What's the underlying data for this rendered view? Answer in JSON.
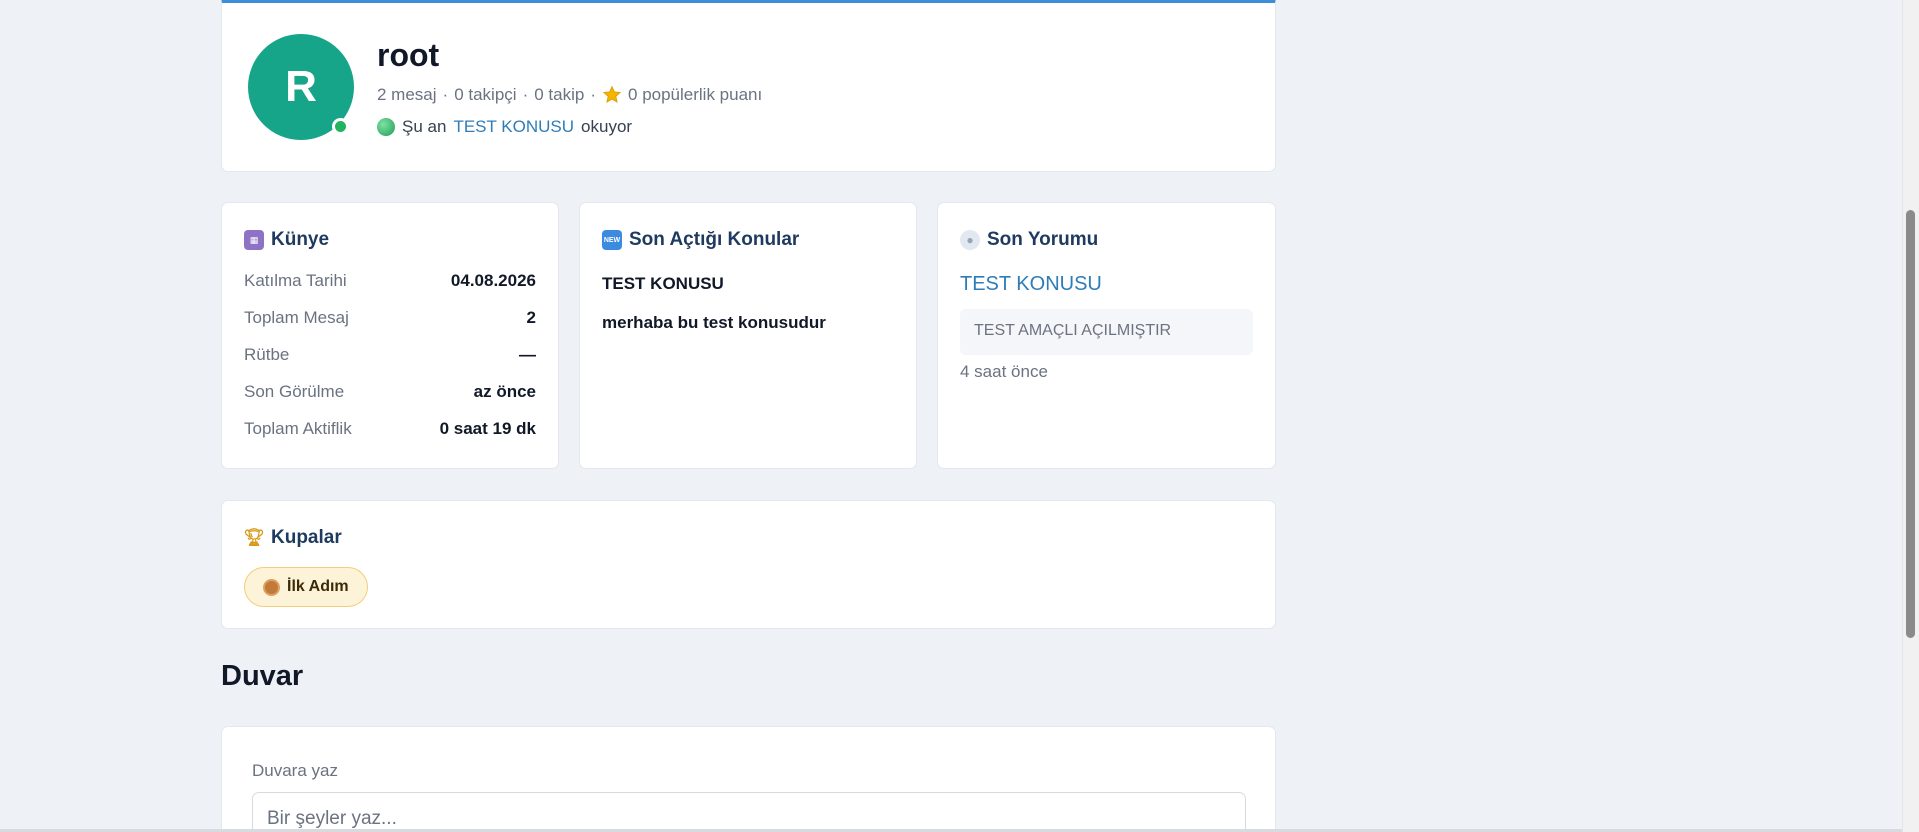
{
  "profile": {
    "avatar_letter": "R",
    "username": "root",
    "stats_messages": "2 mesaj",
    "stats_followers": "0 takipçi",
    "stats_following": "0 takip",
    "stats_sep": "·",
    "stats_popularity": "0 popülerlik puanı",
    "reading_prefix": "Şu an",
    "reading_topic": "TEST KONUSU",
    "reading_suffix": "okuyor"
  },
  "kunye": {
    "title": "Künye",
    "rows": [
      {
        "label": "Katılma Tarihi",
        "value": "04.08.2026"
      },
      {
        "label": "Toplam Mesaj",
        "value": "2"
      },
      {
        "label": "Rütbe",
        "value": "—"
      },
      {
        "label": "Son Görülme",
        "value": "az önce"
      },
      {
        "label": "Toplam Aktiflik",
        "value": "0 saat 19 dk"
      }
    ]
  },
  "konular": {
    "title": "Son Açtığı Konular",
    "icon_text": "NEW",
    "items": [
      "TEST KONUSU",
      "merhaba bu test konusudur"
    ]
  },
  "yorum": {
    "title": "Son Yorumu",
    "topic_link": "TEST KONUSU",
    "quote": "TEST AMAÇLI AÇILMIŞTIR",
    "time": "4 saat önce"
  },
  "kupalar": {
    "title": "Kupalar",
    "badges": [
      "İlk Adım"
    ]
  },
  "wall": {
    "title": "Duvar",
    "label": "Duvara yaz",
    "placeholder": "Bir şeyler yaz..."
  },
  "colors": {
    "accent": "#3b8fd9",
    "avatar": "#17a589",
    "online": "#22b35e",
    "link": "#2e7db8"
  }
}
